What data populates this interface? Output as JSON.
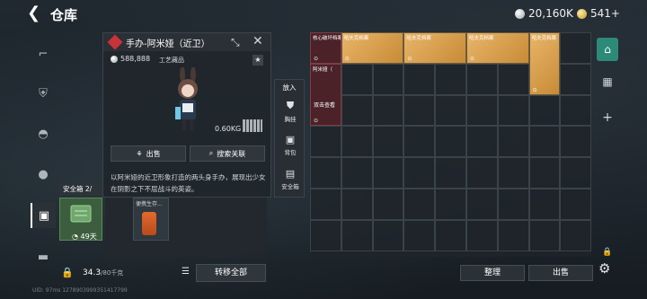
{
  "header": {
    "title": "仓库",
    "back_icon": "back-arrow-icon",
    "silver_amount": "20,160K",
    "gold_amount": "541+"
  },
  "rail": {
    "items": [
      {
        "icon": "rifle-icon",
        "glyph": "⌐"
      },
      {
        "icon": "vest-icon",
        "glyph": "⛨"
      },
      {
        "icon": "helmet-icon",
        "glyph": "◓"
      },
      {
        "icon": "grenade-icon",
        "glyph": "●"
      },
      {
        "icon": "backpack-icon",
        "glyph": "▣"
      },
      {
        "icon": "briefcase-icon",
        "glyph": "▬"
      }
    ]
  },
  "detail": {
    "name": "手办-阿米娅（近卫）",
    "price": "588,888",
    "tag": "工艺藏品",
    "weight": "0.60KG",
    "sell_label": "出售",
    "search_label": "搜索关联",
    "description": "以阿米娅的近卫形象打造的两头身手办，展现出少女在阴影之下不屈战斗的英姿。"
  },
  "put_in": {
    "title": "放入",
    "items": [
      {
        "label": "胸挂",
        "icon": "chest-rig-icon"
      },
      {
        "label": "背包",
        "icon": "backpack-icon"
      },
      {
        "label": "安全箱",
        "icon": "safebox-icon"
      }
    ]
  },
  "safebox": {
    "title": "安全箱",
    "count": "2/",
    "timer": "49天",
    "lower_item_label": "便携生存..."
  },
  "capacity": {
    "value": "34.3",
    "unit": "/80千克"
  },
  "buttons": {
    "transfer_all": "转移全部",
    "sort": "整理",
    "sell": "出售"
  },
  "warehouse": {
    "items": [
      {
        "label": "核心破坏档案",
        "style": "red",
        "col": 0,
        "row": 0,
        "w": 1,
        "h": 1
      },
      {
        "label": "哈夫克档案",
        "style": "box",
        "col": 1,
        "row": 0,
        "w": 2,
        "h": 1
      },
      {
        "label": "哈夫克档案",
        "style": "box",
        "col": 3,
        "row": 0,
        "w": 2,
        "h": 1
      },
      {
        "label": "哈夫克档案",
        "style": "box",
        "col": 5,
        "row": 0,
        "w": 2,
        "h": 1
      },
      {
        "label": "哈夫克档案",
        "style": "box",
        "col": 7,
        "row": 0,
        "w": 1,
        "h": 2
      },
      {
        "label": "阿米娅（",
        "style": "red",
        "col": 0,
        "row": 1,
        "w": 1,
        "h": 2,
        "foot": "双击查看"
      }
    ]
  },
  "footer": {
    "uid": "UID: 97ms 1278903999351417799"
  }
}
